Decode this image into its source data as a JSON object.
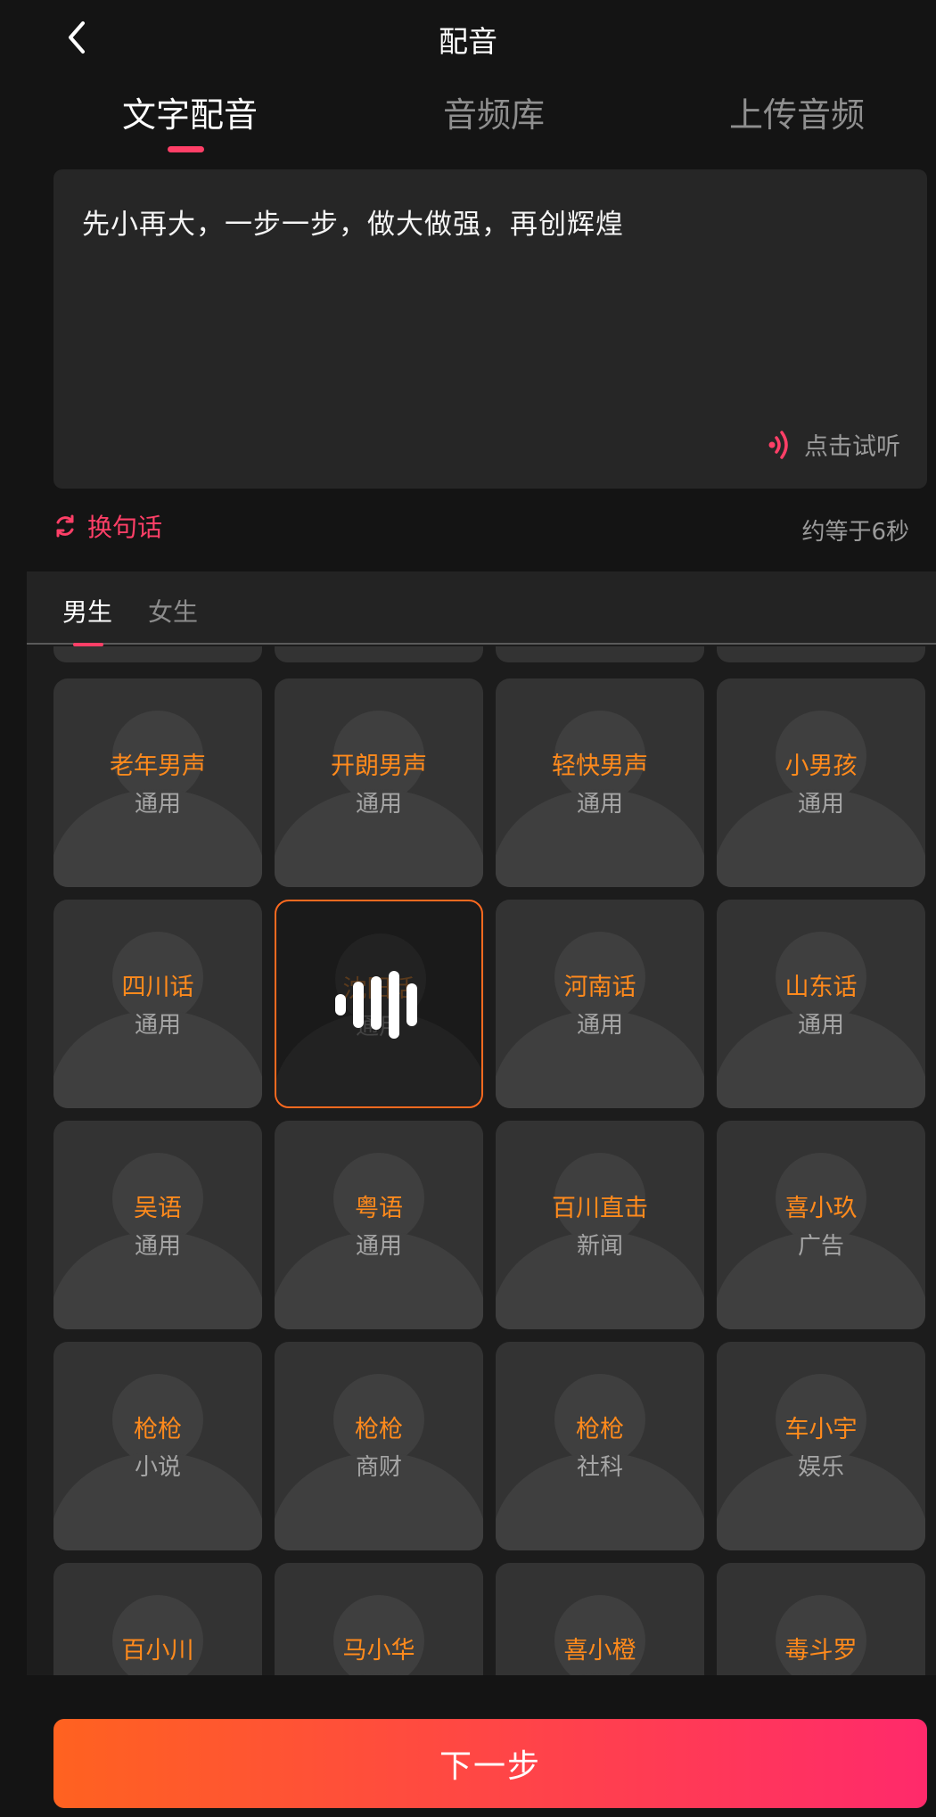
{
  "header": {
    "title": "配音"
  },
  "tabs": [
    {
      "label": "文字配音",
      "active": true
    },
    {
      "label": "音频库",
      "active": false
    },
    {
      "label": "上传音频",
      "active": false
    }
  ],
  "editor": {
    "text": "先小再大，一步一步，做大做强，再创辉煌",
    "preview_label": "点击试听"
  },
  "actions": {
    "swap_label": "换句话",
    "duration": "约等于6秒"
  },
  "gender_tabs": [
    {
      "label": "男生",
      "active": true
    },
    {
      "label": "女生",
      "active": false
    }
  ],
  "voices": [
    {
      "name": "老年男声",
      "category": "通用"
    },
    {
      "name": "开朗男声",
      "category": "通用"
    },
    {
      "name": "轻快男声",
      "category": "通用"
    },
    {
      "name": "小男孩",
      "category": "通用"
    },
    {
      "name": "四川话",
      "category": "通用"
    },
    {
      "name": "沈阳话",
      "category": "通用",
      "selected": true,
      "playing": true
    },
    {
      "name": "河南话",
      "category": "通用"
    },
    {
      "name": "山东话",
      "category": "通用"
    },
    {
      "name": "吴语",
      "category": "通用"
    },
    {
      "name": "粤语",
      "category": "通用"
    },
    {
      "name": "百川直击",
      "category": "新闻"
    },
    {
      "name": "喜小玖",
      "category": "广告"
    },
    {
      "name": "枪枪",
      "category": "小说"
    },
    {
      "name": "枪枪",
      "category": "商财"
    },
    {
      "name": "枪枪",
      "category": "社科"
    },
    {
      "name": "车小宇",
      "category": "娱乐"
    },
    {
      "name": "百小川",
      "category": ""
    },
    {
      "name": "马小华",
      "category": ""
    },
    {
      "name": "喜小橙",
      "category": ""
    },
    {
      "name": "毒斗罗",
      "category": ""
    }
  ],
  "footer": {
    "next_label": "下一步"
  },
  "colors": {
    "accent_pink": "#ff3f67",
    "accent_orange": "#ff8a1c",
    "button_gradient_start": "#ff6220",
    "button_gradient_end": "#ff2a6b"
  }
}
